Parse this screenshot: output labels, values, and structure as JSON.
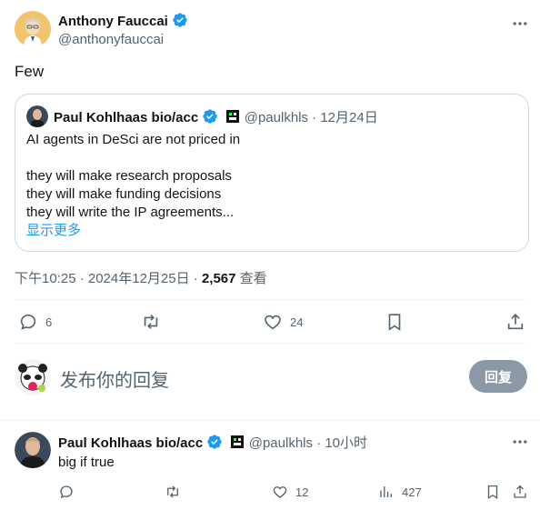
{
  "post": {
    "author_name": "Anthony Fauccai",
    "author_handle": "@anthonyfauccai",
    "text": "Few",
    "timestamp": "下午10:25 · 2024年12月25日 · ",
    "views_count": "2,567",
    "views_label": " 查看",
    "replies": "6",
    "likes": "24"
  },
  "quote": {
    "author_name": "Paul Kohlhaas bio/acc",
    "handle_date": "@paulkhls · 12月24日",
    "lines": [
      "AI agents in DeSci are not priced in",
      "they will make research proposals",
      "they will make funding decisions",
      "they will write the IP agreements..."
    ],
    "show_more": "显示更多"
  },
  "composer": {
    "placeholder": "发布你的回复",
    "reply_button": "回复"
  },
  "reply": {
    "author_name": "Paul Kohlhaas bio/acc",
    "handle_time": "@paulkhls · 10小时",
    "text": "big if true",
    "replies": "",
    "retweets": "",
    "likes": "12",
    "views": "427"
  },
  "colors": {
    "accent": "#1d9bf0",
    "text": "#0f1419",
    "muted": "#536471",
    "border": "#cfd9de"
  }
}
